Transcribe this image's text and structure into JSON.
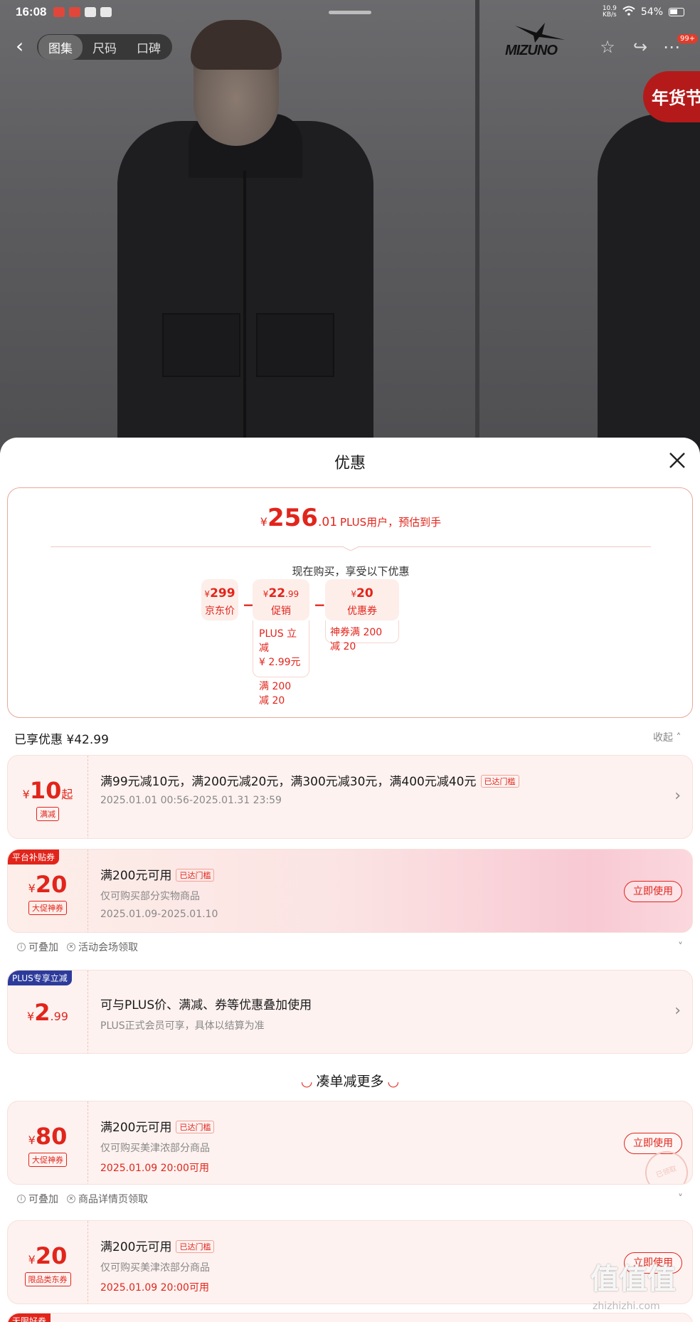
{
  "status_bar": {
    "time": "16:08",
    "speed_top": "10.9",
    "speed_unit": "KB/s",
    "battery": "54%"
  },
  "top_nav": {
    "tabs": [
      {
        "label": "图集"
      },
      {
        "label": "尺码"
      },
      {
        "label": "口碑"
      }
    ],
    "brand": "MIZUNO",
    "cart_badge": "99+",
    "festival": "年货节"
  },
  "sheet": {
    "title": "优惠",
    "summary": {
      "currency": "¥",
      "price_int": "256",
      "price_dec": ".01",
      "price_note": "PLUS用户，预估到手",
      "subtitle": "现在购买，享受以下优惠",
      "items": [
        {
          "amount": "299",
          "decimal": "",
          "label": "京东价"
        },
        {
          "amount": "22",
          "decimal": ".99",
          "label": "促销",
          "details": [
            "PLUS 立减",
            "¥ 2.99元",
            "满 200 减 20"
          ]
        },
        {
          "amount": "20",
          "decimal": "",
          "label": "优惠券",
          "details": [
            "神券满 200 减 20"
          ]
        }
      ],
      "operator": "−"
    },
    "enjoyed": "已享优惠 ¥42.99",
    "collapse": "收起",
    "coupons": [
      {
        "currency": "¥",
        "amount": "10",
        "suffix": "起",
        "type": "满减",
        "title": "满99元减10元，满200元减20元，满300元减30元，满400元减40元",
        "tag": "已达门槛",
        "date": "2025.01.01 00:56-2025.01.31 23:59"
      },
      {
        "corner": "平台补贴券",
        "currency": "¥",
        "amount": "20",
        "type": "大促神券",
        "title": "满200元可用",
        "tag": "已达门槛",
        "sub": "仅可购买部分实物商品",
        "date": "2025.01.09-2025.01.10",
        "button": "立即使用",
        "foot": [
          "可叠加",
          "活动会场领取"
        ]
      },
      {
        "corner": "PLUS专享立减",
        "currency": "¥",
        "amount": "2",
        "decimal": ".99",
        "title": "可与PLUS价、满减、券等优惠叠加使用",
        "sub": "PLUS正式会员可享，具体以结算为准"
      }
    ],
    "more_title": "凑单减更多",
    "more_coupons": [
      {
        "currency": "¥",
        "amount": "80",
        "type": "大促神券",
        "title": "满200元可用",
        "tag": "已达门槛",
        "sub": "仅可购买美津浓部分商品",
        "date": "2025.01.09 20:00可用",
        "button": "立即使用",
        "stamp": "已领取",
        "foot": [
          "可叠加",
          "商品详情页领取"
        ]
      },
      {
        "currency": "¥",
        "amount": "20",
        "type": "限品类东券",
        "title": "满200元可用",
        "tag": "已达门槛",
        "sub": "仅可购买美津浓部分商品",
        "date": "2025.01.09 20:00可用",
        "button": "立即使用"
      }
    ],
    "last_corner": "无限好券"
  },
  "watermark": {
    "text": "值值值",
    "url": "zhizhizhi.com"
  },
  "colors": {
    "accent": "#e1251b",
    "plus_blue": "#2c3b9b"
  }
}
